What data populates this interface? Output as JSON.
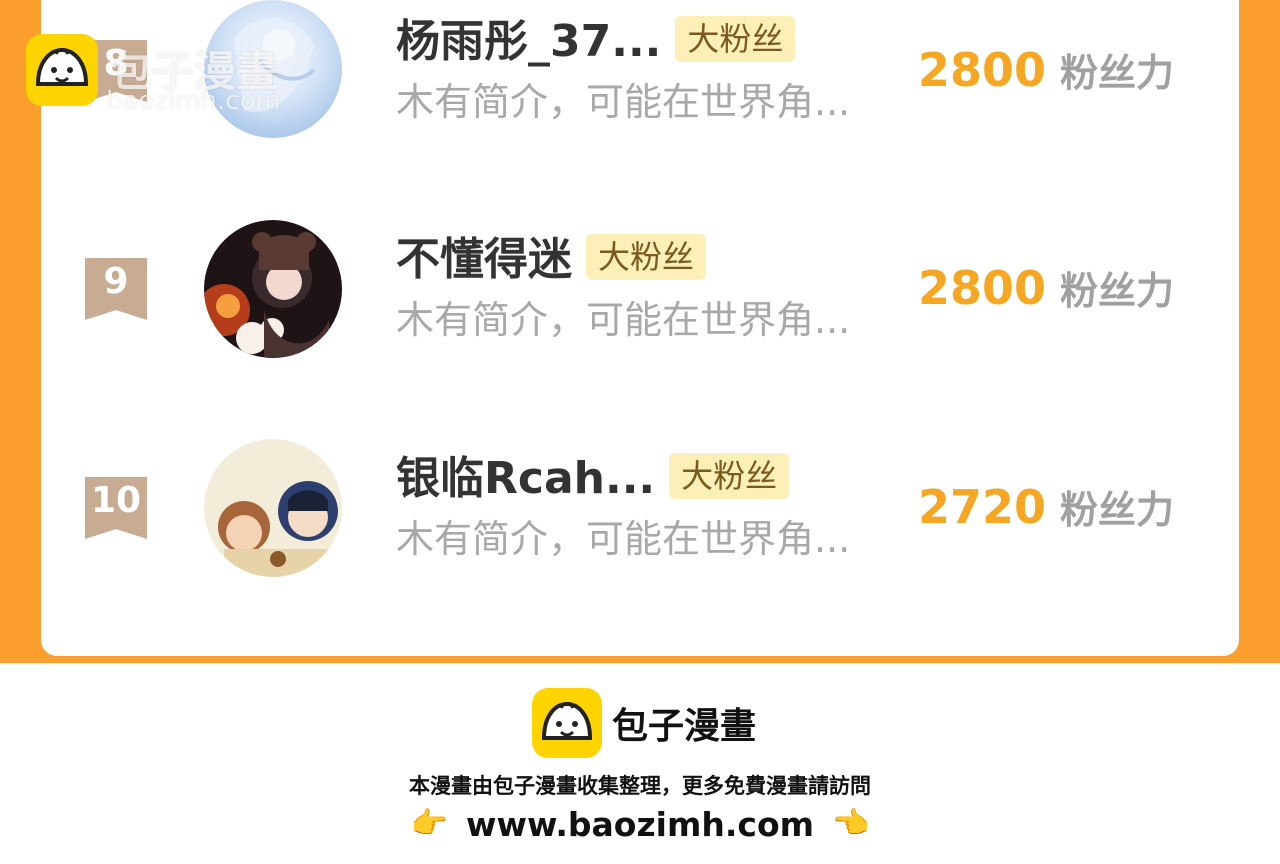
{
  "rows": [
    {
      "rank": "8",
      "name": "杨雨彤_37...",
      "badge": "大粉丝",
      "description": "木有简介，可能在世界角...",
      "score": "2800",
      "score_unit": "粉丝力"
    },
    {
      "rank": "9",
      "name": "不懂得迷",
      "badge": "大粉丝",
      "description": "木有简介，可能在世界角...",
      "score": "2800",
      "score_unit": "粉丝力"
    },
    {
      "rank": "10",
      "name": "银临Rcah...",
      "badge": "大粉丝",
      "description": "木有简介，可能在世界角...",
      "score": "2720",
      "score_unit": "粉丝力"
    }
  ],
  "watermark": {
    "title": "包子漫畫",
    "url": "baozimh.com"
  },
  "footer": {
    "brand": "包子漫畫",
    "caption": "本漫畫由包子漫畫收集整理，更多免費漫畫請訪問",
    "url": "www.baozimh.com",
    "left_icon": "pointing-right-hand-icon",
    "right_icon": "pointing-left-hand-icon"
  },
  "colors": {
    "frame": "#fb9e2d",
    "score": "#f5a623",
    "badge_bg": "#fdefb8",
    "rank_ribbon": "#c7ab93",
    "logo_yellow": "#ffd400"
  }
}
